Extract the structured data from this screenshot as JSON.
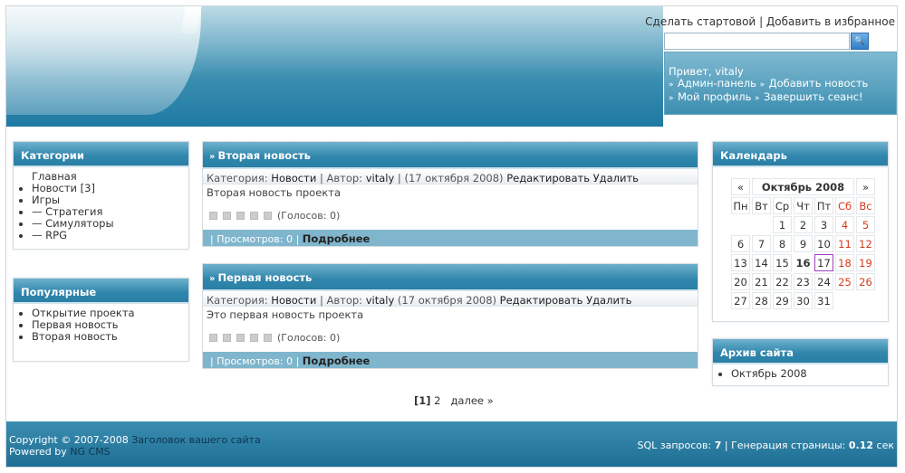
{
  "header": {
    "links": [
      "Сделать стартовой",
      "Добавить в избранное"
    ],
    "search_button": "🔍",
    "user": {
      "greeting": "Привет, vitaly",
      "links": [
        "Админ-панель",
        "Добавить новость",
        "Мой профиль",
        "Завершить сеанс!"
      ]
    }
  },
  "categories": {
    "title": "Категории",
    "home": "Главная",
    "items": [
      "Новости [3]",
      "Игры",
      "— Стратегия",
      "— Симуляторы",
      "— RPG"
    ]
  },
  "popular": {
    "title": "Популярные",
    "items": [
      "Открытие проекта",
      "Первая новость",
      "Вторая новость"
    ]
  },
  "news": [
    {
      "title": "Вторая новость",
      "category_label": "Категория:",
      "category": "Новости",
      "author_label": "Автор:",
      "author": "vitaly",
      "date": "(17 октября 2008)",
      "edit": "Редактировать",
      "delete": "Удалить",
      "body": "Вторая новость проекта",
      "votes": "(Голосов: 0)",
      "views": "| Просмотров: 0 |",
      "more": "Подробнее"
    },
    {
      "title": "Первая новость",
      "category_label": "Категория:",
      "category": "Новости",
      "author_label": "Автор:",
      "author": "vitaly",
      "date": "(17 октября 2008)",
      "edit": "Редактировать",
      "delete": "Удалить",
      "body": "Это первая новость проекта",
      "votes": "(Голосов: 0)",
      "views": "| Просмотров: 0 |",
      "more": "Подробнее"
    }
  ],
  "pager": {
    "current": "[1]",
    "page2": "2",
    "next": "далее »"
  },
  "calendar": {
    "title": "Календарь",
    "prev": "«",
    "month": "Октябрь 2008",
    "next": "»",
    "weekdays": [
      "Пн",
      "Вт",
      "Ср",
      "Чт",
      "Пт",
      "Сб",
      "Вс"
    ],
    "weeks": [
      [
        "",
        "",
        "1",
        "2",
        "3",
        "4",
        "5"
      ],
      [
        "6",
        "7",
        "8",
        "9",
        "10",
        "11",
        "12"
      ],
      [
        "13",
        "14",
        "15",
        "16",
        "17",
        "18",
        "19"
      ],
      [
        "20",
        "21",
        "22",
        "23",
        "24",
        "25",
        "26"
      ],
      [
        "27",
        "28",
        "29",
        "30",
        "31",
        "",
        ""
      ]
    ],
    "today": "16",
    "selected": "17"
  },
  "archive": {
    "title": "Архив сайта",
    "items": [
      "Октябрь 2008"
    ]
  },
  "footer": {
    "copyright": "Copyright © 2007-2008",
    "site_title": "Заголовок вашего сайта",
    "powered": "Powered by",
    "cms": "NG CMS",
    "sql_label": "SQL запросов:",
    "sql_value": "7",
    "gen_label": "| Генерация страницы:",
    "gen_value": "0.12",
    "gen_unit": "сек"
  }
}
